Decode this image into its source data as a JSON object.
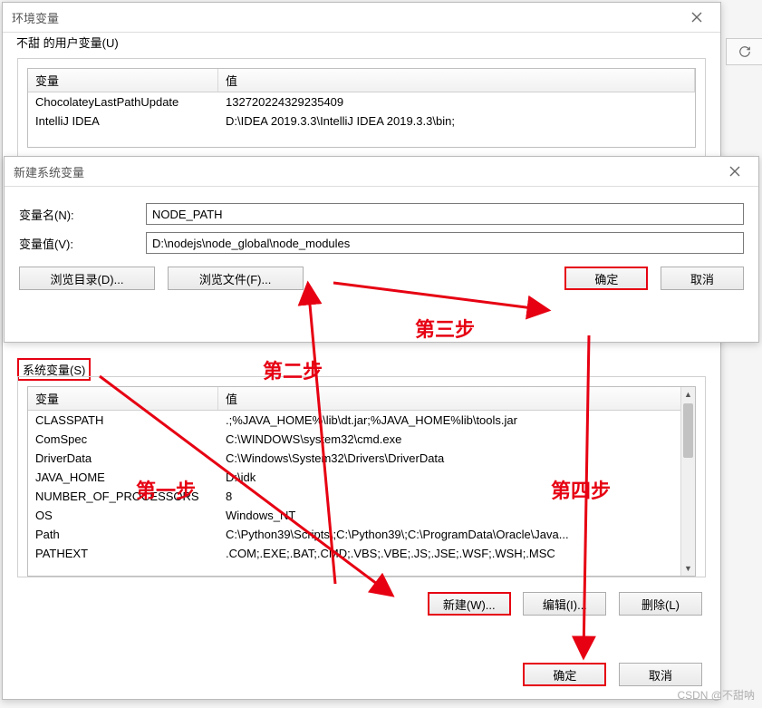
{
  "watermark": "CSDN @不甜呐",
  "env_dialog": {
    "title": "环境变量",
    "user_group": "不甜 的用户变量(U)",
    "sys_group": "系统变量(S)",
    "header_var": "变量",
    "header_val": "值",
    "user_rows": [
      {
        "var": "ChocolateyLastPathUpdate",
        "val": "132720224329235409"
      },
      {
        "var": "IntelliJ IDEA",
        "val": "D:\\IDEA 2019.3.3\\IntelliJ IDEA 2019.3.3\\bin;"
      }
    ],
    "sys_rows": [
      {
        "var": "CLASSPATH",
        "val": ".;%JAVA_HOME%\\lib\\dt.jar;%JAVA_HOME%lib\\tools.jar"
      },
      {
        "var": "ComSpec",
        "val": "C:\\WINDOWS\\system32\\cmd.exe"
      },
      {
        "var": "DriverData",
        "val": "C:\\Windows\\System32\\Drivers\\DriverData"
      },
      {
        "var": "JAVA_HOME",
        "val": "D:\\jdk"
      },
      {
        "var": "NUMBER_OF_PROCESSORS",
        "val": "8"
      },
      {
        "var": "OS",
        "val": "Windows_NT"
      },
      {
        "var": "Path",
        "val": "C:\\Python39\\Scripts\\;C:\\Python39\\;C:\\ProgramData\\Oracle\\Java..."
      },
      {
        "var": "PATHEXT",
        "val": ".COM;.EXE;.BAT;.CMD;.VBS;.VBE;.JS;.JSE;.WSF;.WSH;.MSC"
      }
    ],
    "btn_new": "新建(W)...",
    "btn_edit": "编辑(I)...",
    "btn_delete": "删除(L)",
    "btn_ok": "确定",
    "btn_cancel": "取消"
  },
  "new_dialog": {
    "title": "新建系统变量",
    "name_label": "变量名(N):",
    "value_label": "变量值(V):",
    "name_value": "NODE_PATH",
    "value_value": "D:\\nodejs\\node_global\\node_modules",
    "browse_dir": "浏览目录(D)...",
    "browse_file": "浏览文件(F)...",
    "btn_ok": "确定",
    "btn_cancel": "取消"
  },
  "annotations": {
    "step1": "第一步",
    "step2": "第二步",
    "step3": "第三步",
    "step4": "第四步",
    "colors": {
      "red": "#e60012"
    }
  }
}
